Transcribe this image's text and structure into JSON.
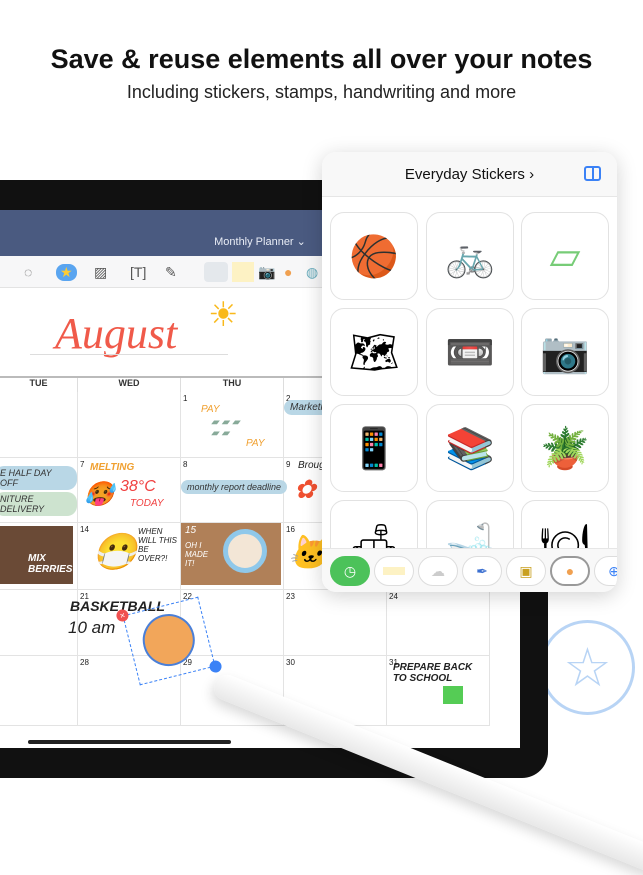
{
  "headline": "Save & reuse elements all over your notes",
  "subheadline": "Including stickers, stamps, handwriting and more",
  "app": {
    "title": "Monthly Planner",
    "title_chevron": "⌄"
  },
  "toolbar": {
    "icons": [
      "lasso-icon",
      "sticker-icon",
      "image-icon",
      "text-icon",
      "laser-pointer-icon"
    ]
  },
  "calendar": {
    "month": "August",
    "days": [
      "TUE",
      "WED",
      "THU",
      "",
      ""
    ],
    "dates": [
      "1",
      "2",
      "7",
      "8",
      "9",
      "14",
      "15",
      "16",
      "21",
      "22",
      "23",
      "24",
      "28",
      "29",
      "30",
      "31"
    ],
    "notes": {
      "pay": "PAY",
      "pay2": "PAY",
      "marketing": "Marketing",
      "halfday": "E HALF DAY OFF",
      "furniture": "NITURE DELIVERY",
      "melting": "MELTING",
      "temp": "38°C",
      "today": "TODAY",
      "report": "monthly report deadline",
      "brought": "Brought",
      "mix": "MIX BERRIES",
      "when": "WHEN WILL THIS BE OVER?!",
      "ohmade": "OH I MADE IT!",
      "basketball": "BASKETBALL",
      "time": "10 am",
      "prepare": "PREPARE BACK TO SCHOOL"
    }
  },
  "panel": {
    "title": "Everyday Stickers",
    "title_chevron": "›",
    "stickers": [
      "basketball",
      "bicycle",
      "yoga-mat",
      "map",
      "cassette",
      "camera",
      "tablet",
      "table-books",
      "plant",
      "sofa",
      "bath",
      "breakfast"
    ],
    "tabs": [
      "recent",
      "tape",
      "cloud",
      "pen",
      "cookie",
      "basketball",
      "add"
    ]
  },
  "colors": {
    "accent": "#3b82f6",
    "header": "#4a5a80",
    "recent_tab": "#4cc25a",
    "month": "#f05a4a"
  }
}
